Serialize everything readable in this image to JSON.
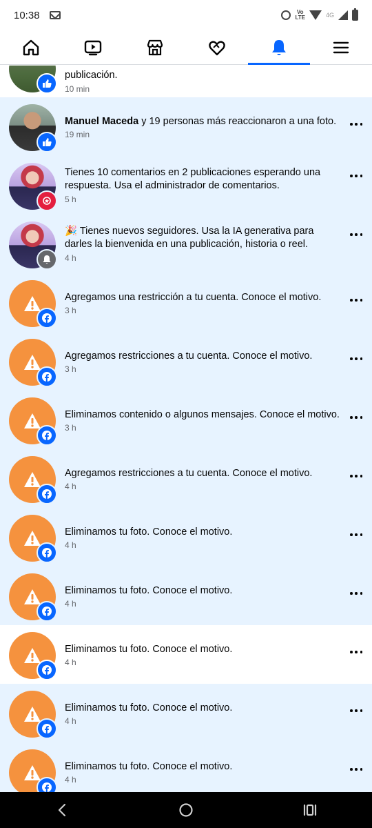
{
  "status_bar": {
    "time": "10:38",
    "volte_line1": "Vo",
    "volte_line2": "LTE",
    "network": "4G"
  },
  "tabs": [
    {
      "name": "home",
      "icon": "home-icon",
      "active": false
    },
    {
      "name": "video",
      "icon": "video-icon",
      "active": false
    },
    {
      "name": "marketplace",
      "icon": "marketplace-icon",
      "active": false
    },
    {
      "name": "dating",
      "icon": "heart-icon",
      "active": false
    },
    {
      "name": "notifications",
      "icon": "bell-icon",
      "active": true
    },
    {
      "name": "menu",
      "icon": "menu-icon",
      "active": false
    }
  ],
  "colors": {
    "accent": "#0866ff",
    "unread_bg": "#e7f3ff",
    "warning_orange": "#f5923e",
    "secondary_text": "#65676b"
  },
  "notifications": [
    {
      "text_bold": "",
      "text": "publicación.",
      "time": "10 min",
      "badge": "like-icon",
      "unread": false
    },
    {
      "text_bold": "Manuel Maceda",
      "text": " y 19 personas más reaccionaron a una foto.",
      "time": "19 min",
      "badge": "like-icon",
      "unread": true
    },
    {
      "text_bold": "",
      "text": "Tienes 10 comentarios en 2 publicaciones esperando una respuesta. Usa el administrador de comentarios.",
      "time": "5 h",
      "badge": "star-icon",
      "unread": true
    },
    {
      "text_bold": "",
      "text": "🎉 Tienes nuevos seguidores. Usa la IA generativa para darles la bienvenida en una publicación, historia o reel.",
      "time": "4 h",
      "badge": "bell-icon",
      "unread": true
    },
    {
      "text_bold": "",
      "text": "Agregamos una restricción a tu cuenta. Conoce el motivo.",
      "time": "3 h",
      "badge": "facebook-icon",
      "unread": true
    },
    {
      "text_bold": "",
      "text": "Agregamos restricciones a tu cuenta. Conoce el motivo.",
      "time": "3 h",
      "badge": "facebook-icon",
      "unread": true
    },
    {
      "text_bold": "",
      "text": "Eliminamos contenido o algunos mensajes. Conoce el motivo.",
      "time": "3 h",
      "badge": "facebook-icon",
      "unread": true
    },
    {
      "text_bold": "",
      "text": "Agregamos restricciones a tu cuenta. Conoce el motivo.",
      "time": "4 h",
      "badge": "facebook-icon",
      "unread": true
    },
    {
      "text_bold": "",
      "text": "Eliminamos tu foto. Conoce el motivo.",
      "time": "4 h",
      "badge": "facebook-icon",
      "unread": true
    },
    {
      "text_bold": "",
      "text": "Eliminamos tu foto. Conoce el motivo.",
      "time": "4 h",
      "badge": "facebook-icon",
      "unread": true
    },
    {
      "text_bold": "",
      "text": "Eliminamos tu foto. Conoce el motivo.",
      "time": "4 h",
      "badge": "facebook-icon",
      "unread": false
    },
    {
      "text_bold": "",
      "text": "Eliminamos tu foto. Conoce el motivo.",
      "time": "4 h",
      "badge": "facebook-icon",
      "unread": true
    },
    {
      "text_bold": "",
      "text": "Eliminamos tu foto. Conoce el motivo.",
      "time": "4 h",
      "badge": "facebook-icon",
      "unread": true
    }
  ],
  "nav_bar": {
    "back": "back-icon",
    "home": "home-circle-icon",
    "recents": "recents-icon"
  }
}
